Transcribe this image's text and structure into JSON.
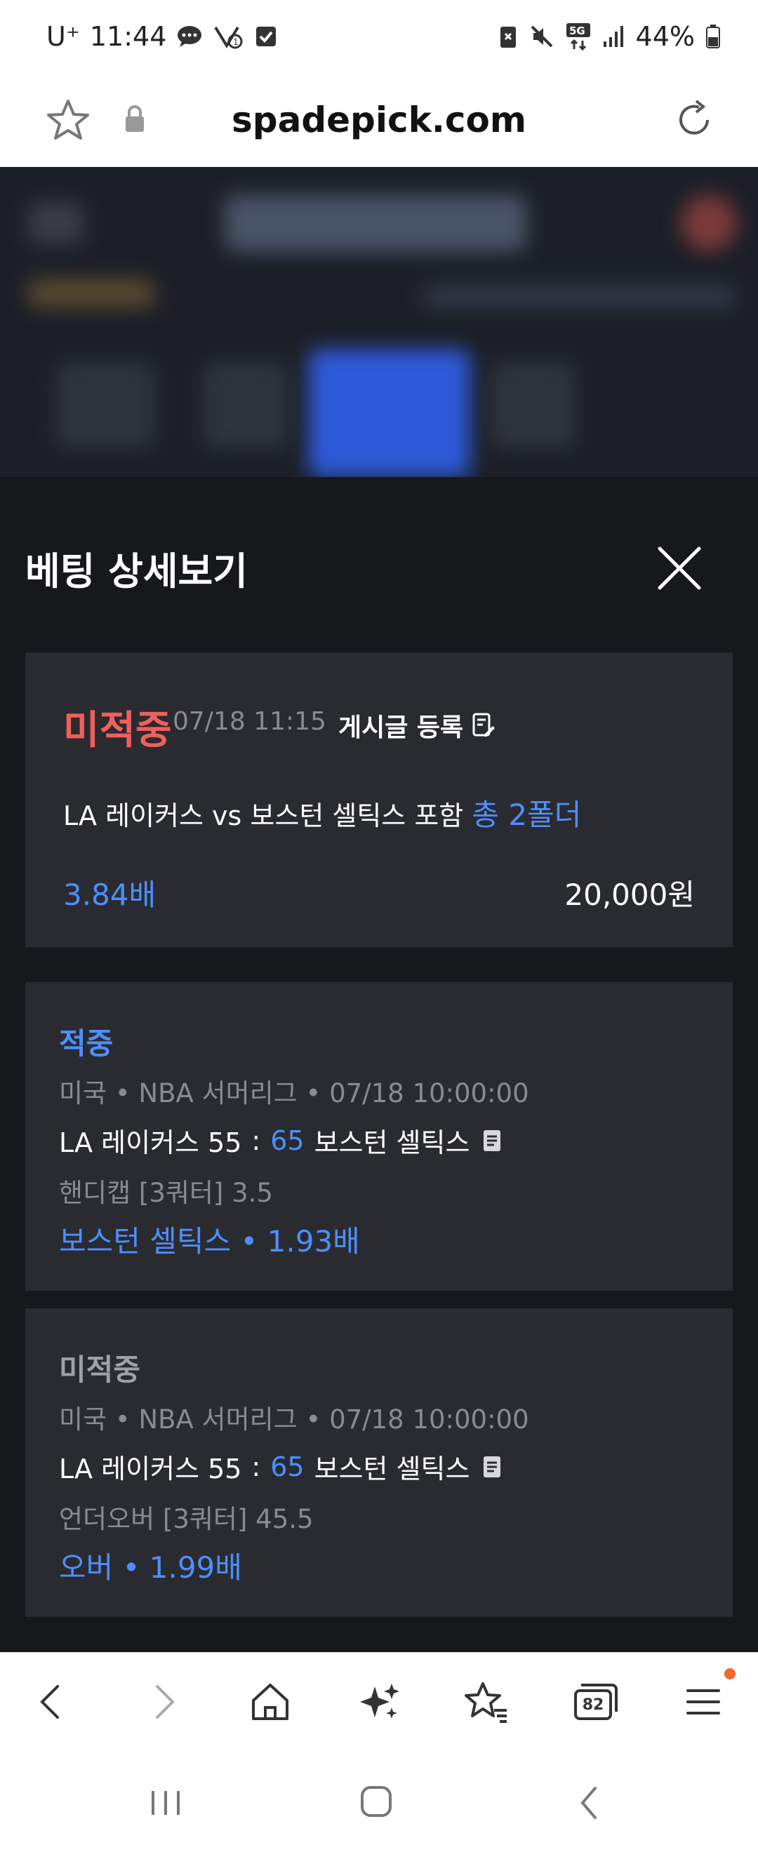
{
  "status_bar": {
    "carrier": "U⁺",
    "time": "11:44",
    "battery": "44%",
    "network": "5G"
  },
  "url_bar": {
    "domain": "spadepick.com"
  },
  "panel": {
    "title": "베팅 상세보기"
  },
  "summary": {
    "status": "미적중",
    "time": "07/18 11:15",
    "post_label": "게시글 등록",
    "desc_prefix": "LA 레이커스 vs 보스턴 셀틱스 포함",
    "desc_highlight": "총 2폴더",
    "odds": "3.84배",
    "amount": "20,000원"
  },
  "legs": [
    {
      "status": "적중",
      "meta": "미국 • NBA 서머리그 • 07/18 10:00:00",
      "home": "LA 레이커스 55",
      "sep": ":",
      "away_score": "65",
      "away": "보스턴 셀틱스",
      "market": "핸디캡 [3쿼터] 3.5",
      "pick": "보스턴 셀틱스 • 1.93배"
    },
    {
      "status": "미적중",
      "meta": "미국 • NBA 서머리그 • 07/18 10:00:00",
      "home": "LA 레이커스 55",
      "sep": ":",
      "away_score": "65",
      "away": "보스턴 셀틱스",
      "market": "언더오버 [3쿼터] 45.5",
      "pick": "오버 • 1.99배"
    }
  ],
  "bottom_bar": {
    "tab_count": "82"
  },
  "colors": {
    "miss_red": "#f0605b",
    "accent_blue": "#4d8fff",
    "card_bg": "#2a2b30",
    "panel_bg": "#17181c"
  }
}
